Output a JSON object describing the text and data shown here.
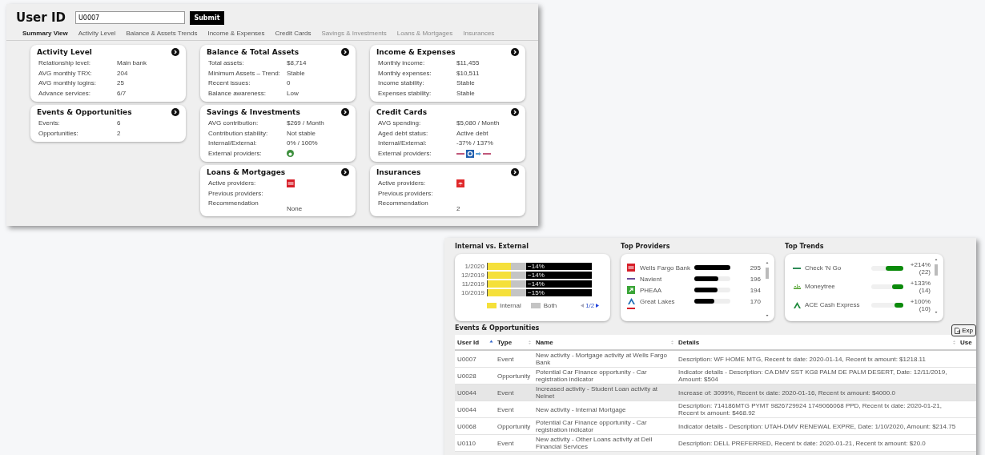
{
  "dashboard_window": {
    "user_id": {
      "label": "User ID",
      "value": "U0007"
    },
    "submit": "Submit",
    "tabs": [
      {
        "label": "Summary View",
        "selected": true,
        "disabled": false
      },
      {
        "label": "Activity Level",
        "selected": false,
        "disabled": false
      },
      {
        "label": "Balance & Assets Trends",
        "selected": false,
        "disabled": false
      },
      {
        "label": "Income & Expenses",
        "selected": false,
        "disabled": false
      },
      {
        "label": "Credit Cards",
        "selected": false,
        "disabled": false
      },
      {
        "label": "Savings & Investments",
        "selected": false,
        "disabled": true
      },
      {
        "label": "Loans & Mortgages",
        "selected": false,
        "disabled": true
      },
      {
        "label": "Insurances",
        "selected": false,
        "disabled": true
      }
    ],
    "columns": [
      [
        {
          "title": "Activity Level",
          "rows": [
            {
              "kind": "text",
              "label": "Relationship level:",
              "value": "Main bank"
            },
            {
              "kind": "text",
              "label": "AVG monthly TRX:",
              "value": "204"
            },
            {
              "kind": "text",
              "label": "AVG monthly logins:",
              "value": "25"
            },
            {
              "kind": "text",
              "label": "Advance services:",
              "value": "6/7"
            }
          ]
        },
        {
          "title": "Events & Opportunities",
          "rows": [
            {
              "kind": "text",
              "label": "Events:",
              "value": "6"
            },
            {
              "kind": "text",
              "label": "Opportunities:",
              "value": "2"
            }
          ]
        }
      ],
      [
        {
          "title": "Balance & Total Assets",
          "rows": [
            {
              "kind": "text",
              "label": "Total assets:",
              "value": "$8,714"
            },
            {
              "kind": "text",
              "label": "Minimum Assets – Trend:",
              "value": "Stable"
            },
            {
              "kind": "text",
              "label": "Recent issues:",
              "value": "0"
            },
            {
              "kind": "text",
              "label": "Balance awareness:",
              "value": "Low"
            }
          ]
        },
        {
          "title": "Savings & Investments",
          "rows": [
            {
              "kind": "text",
              "label": "AVG contribution:",
              "value": "$269 / Month"
            },
            {
              "kind": "text",
              "label": "Contribution stability:",
              "value": "Not stable"
            },
            {
              "kind": "text",
              "label": "Internal/External:",
              "value": "0% / 100%"
            },
            {
              "kind": "logos",
              "label": "External providers:",
              "logos": [
                {
                  "kind": "ring",
                  "color": "#3d8f3d"
                }
              ]
            }
          ]
        },
        {
          "title": "Loans & Mortgages",
          "rows": [
            {
              "kind": "logos",
              "label": "Active providers:",
              "logos": [
                {
                  "kind": "bank",
                  "color": "#d71e28"
                }
              ]
            },
            {
              "kind": "text",
              "label": "Previous providers:"
            },
            {
              "kind": "lowered",
              "label": "Recommendation",
              "value": "None"
            }
          ]
        }
      ],
      [
        {
          "title": "Income & Expenses",
          "rows": [
            {
              "kind": "text",
              "label": "Monthly income:",
              "value": "$11,455"
            },
            {
              "kind": "text",
              "label": "Monthly expenses:",
              "value": "$10,511"
            },
            {
              "kind": "text",
              "label": "Income stability:",
              "value": "Stable"
            },
            {
              "kind": "text",
              "label": "Expenses stability:",
              "value": "Stable"
            }
          ]
        },
        {
          "title": "Credit Cards",
          "rows": [
            {
              "kind": "text",
              "label": "AVG spending:",
              "value": "$5,080 / Month"
            },
            {
              "kind": "text",
              "label": "Aged debt status:",
              "value": "Active debt"
            },
            {
              "kind": "text",
              "label": "Internal/External:",
              "value": "-37% / 137%"
            },
            {
              "kind": "logos",
              "label": "External providers:",
              "logos": [
                {
                  "kind": "dash",
                  "color": "#c0587a"
                },
                {
                  "kind": "tile",
                  "color": "#1f5fae"
                },
                {
                  "kind": "arrow",
                  "color": "#5a9fd4"
                },
                {
                  "kind": "dash",
                  "color": "#c0587a"
                }
              ]
            }
          ]
        },
        {
          "title": "Insurances",
          "rows": [
            {
              "kind": "logos",
              "label": "Active providers:",
              "logos": [
                {
                  "kind": "umbrella",
                  "color": "#e0282a"
                }
              ]
            },
            {
              "kind": "text",
              "label": "Previous providers:"
            },
            {
              "kind": "lowered",
              "label": "Recommendation",
              "value": "2"
            }
          ]
        }
      ]
    ]
  },
  "report_window": {
    "internal_external": {
      "title": "Internal vs. External",
      "rows": [
        {
          "date": "1/2020",
          "share": "−14%"
        },
        {
          "date": "12/2019",
          "share": "−14%"
        },
        {
          "date": "11/2019",
          "share": "−14%"
        },
        {
          "date": "10/2019",
          "share": "−15%"
        }
      ],
      "legend": [
        {
          "label": "Internal",
          "color": "#f5e03a"
        },
        {
          "label": "Both",
          "color": "#c4c4c4"
        }
      ],
      "pager": "1/2"
    },
    "top_providers": {
      "title": "Top Providers",
      "items": [
        {
          "name": "Wells Fargo Bank",
          "level": 1,
          "count": "295",
          "logo": {
            "kind": "bank",
            "color": "#d71e28"
          }
        },
        {
          "name": "Navient",
          "level": 0.66,
          "count": "196",
          "logo": {
            "kind": "dash",
            "color": "#6b4c9a"
          }
        },
        {
          "name": "PHEAA",
          "level": 0.65,
          "count": "194",
          "logo": {
            "kind": "plus",
            "color": "#3aa537"
          }
        },
        {
          "name": "Great Lakes",
          "level": 0.55,
          "count": "170",
          "logo": {
            "kind": "peak",
            "color": "#1f6fb6"
          }
        }
      ]
    },
    "top_trends": {
      "title": "Top Trends",
      "items": [
        {
          "name": "Check 'N Go",
          "level": 0.55,
          "change": "+214%",
          "count": "(22)",
          "logo": {
            "kind": "dash",
            "color": "#2e8b57"
          }
        },
        {
          "name": "Moneytree",
          "level": 0.35,
          "change": "+133%",
          "count": "(14)",
          "logo": {
            "kind": "sprout",
            "color": "#6ab04c"
          }
        },
        {
          "name": "ACE Cash Express",
          "level": 0.28,
          "change": "+100%",
          "count": "(10)",
          "logo": {
            "kind": "peak",
            "color": "#1e8a3c"
          }
        }
      ]
    },
    "events": {
      "title": "Events & Opportunities",
      "export": "Exp",
      "columns": [
        {
          "label": "User Id",
          "sorted": true
        },
        {
          "label": "Type",
          "sorted": false
        },
        {
          "label": "Name",
          "sorted": false
        },
        {
          "label": "Details",
          "sorted": false
        },
        {
          "label": "Use"
        }
      ],
      "rows": [
        {
          "highlighted": false,
          "cells": [
            "U0007",
            "Event",
            "New activity - Mortgage activity at Wells Fargo Bank",
            "Description: WF HOME MTG, Recent tx date: 2020-01-14, Recent tx amount: $1218.11"
          ]
        },
        {
          "highlighted": false,
          "cells": [
            "U0028",
            "Opportunity",
            "Potential Car Finance opportunity - Car registration indicator",
            "Indicator details - Description: CA DMV SST KG8 PALM DE PALM DESERT, Date: 12/11/2019, Amount: $504"
          ]
        },
        {
          "highlighted": true,
          "cells": [
            "U0044",
            "Event",
            "Increased activity - Student Loan activity at Nelnet",
            "Increase of: 3099%, Recent tx date: 2020-01-16, Recent tx amount: $4000.0"
          ]
        },
        {
          "highlighted": false,
          "cells": [
            "U0044",
            "Event",
            "New activity - Internal Mortgage",
            "Description: 714186MTG PYMT 9826729924 1749066068 PPD, Recent tx date: 2020-01-21, Recent tx amount: $468.92"
          ]
        },
        {
          "highlighted": false,
          "cells": [
            "U0068",
            "Opportunity",
            "Potential Car Finance opportunity - Car registration indicator",
            "Indicator details - Description: UTAH-DMV RENEWAL EXPRE, Date: 1/10/2020, Amount: $214.75"
          ]
        },
        {
          "highlighted": false,
          "cells": [
            "U0110",
            "Event",
            "New activity - Other Loans activity at Dell Financial Services",
            "Description: DELL PREFERRED, Recent tx date: 2020-01-21, Recent tx amount: $20.0"
          ]
        }
      ]
    }
  }
}
